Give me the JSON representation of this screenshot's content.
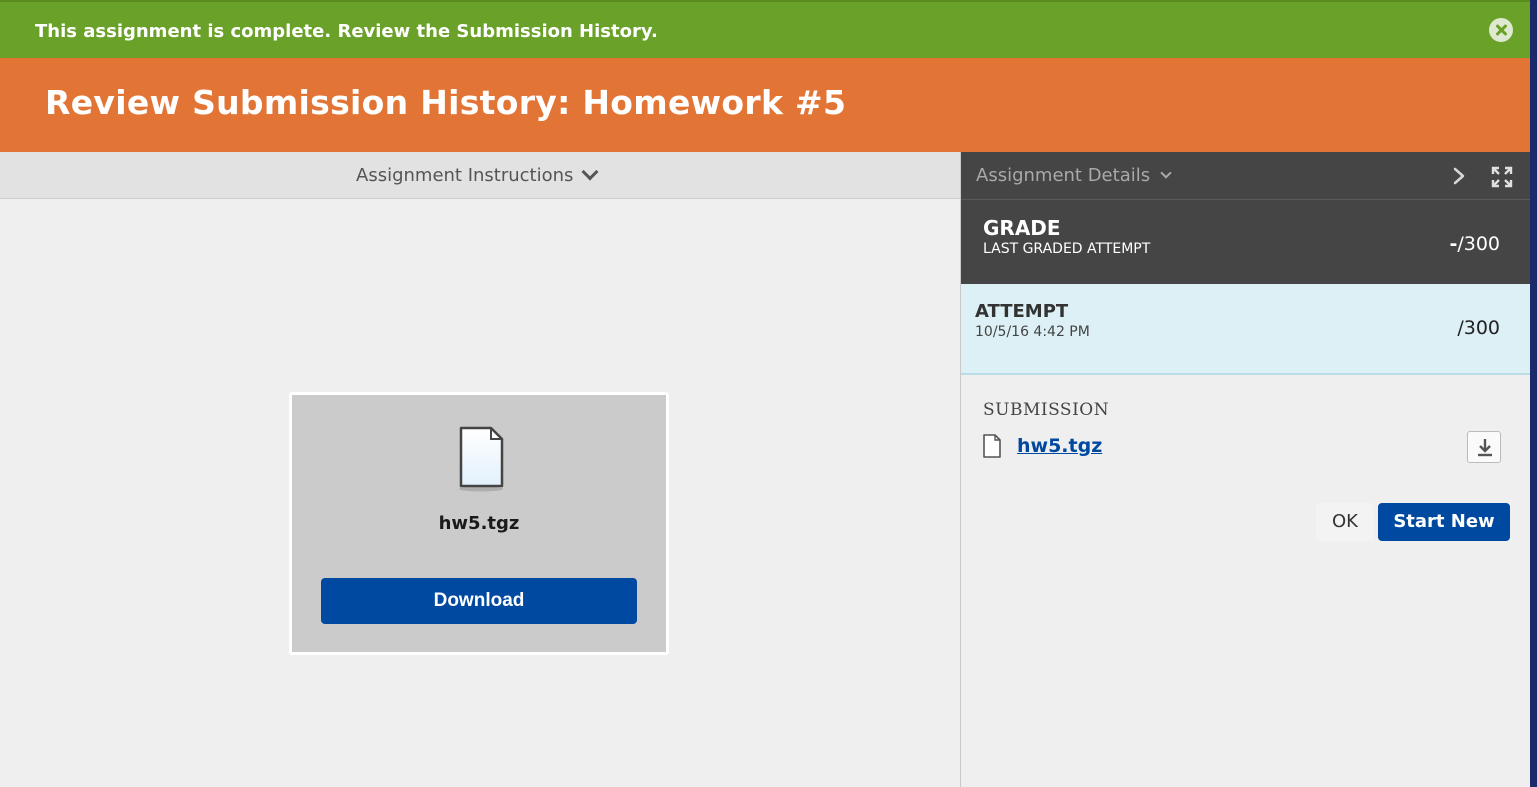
{
  "banner": {
    "message": "This assignment is complete. Review the Submission History.",
    "close_icon": "close-circle-icon",
    "color": "#6aa128"
  },
  "header": {
    "title": "Review Submission History: Homework #5",
    "color": "#e27536"
  },
  "left_pane": {
    "instructions_label": "Assignment Instructions",
    "file": {
      "name": "hw5.tgz",
      "icon": "document-icon",
      "download_label": "Download"
    }
  },
  "right_pane": {
    "details_label": "Assignment Details",
    "grade": {
      "title": "GRADE",
      "subtitle": "LAST GRADED ATTEMPT",
      "score": "-",
      "max": "/300"
    },
    "attempt": {
      "title": "ATTEMPT",
      "date": "10/5/16 4:42 PM",
      "score": "/300"
    },
    "submission": {
      "label": "SUBMISSION",
      "file_name": "hw5.tgz"
    },
    "actions": {
      "ok_label": "OK",
      "start_new_label": "Start New"
    }
  },
  "colors": {
    "primary_blue": "#0049a0",
    "dark_panel": "#454545",
    "attempt_bg": "#dcf0f5"
  }
}
